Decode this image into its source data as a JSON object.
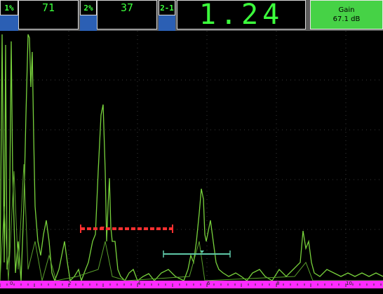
{
  "readings": {
    "r1": {
      "label": "1%",
      "value": "71"
    },
    "r2": {
      "label": "2%",
      "value": "37"
    },
    "r3": {
      "label": "2-1",
      "value": "1.24"
    }
  },
  "gain": {
    "title": "Gain",
    "value": "67.1 dB"
  },
  "scale": {
    "ticks": [
      "0",
      "2",
      "4",
      "6",
      "8",
      "10"
    ]
  },
  "colors": {
    "signal": "#78d23c",
    "gate_a": "#ff3030",
    "gate_b": "#5fc8a8",
    "ruler": "#ff2bff",
    "text": "#3cff3c"
  }
}
